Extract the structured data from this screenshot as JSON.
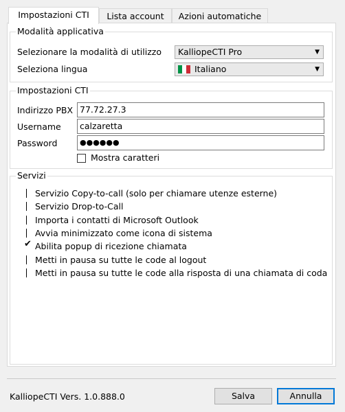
{
  "tabs": [
    {
      "label": "Impostazioni CTI"
    },
    {
      "label": "Lista account"
    },
    {
      "label": "Azioni automatiche"
    }
  ],
  "mode_group": {
    "title": "Modalità applicativa",
    "mode_label": "Selezionare la modalità di utilizzo",
    "mode_value": "KalliopeCTI Pro",
    "language_label": "Seleziona lingua",
    "language_value": "Italiano",
    "flag_colors": [
      "#009246",
      "#ffffff",
      "#ce2b37"
    ]
  },
  "cti_group": {
    "title": "Impostazioni CTI",
    "pbx_label": "Indirizzo PBX",
    "pbx_value": "77.72.27.3",
    "username_label": "Username",
    "username_value": "calzaretta",
    "password_label": "Password",
    "password_value": "●●●●●●",
    "show_chars_label": "Mostra caratteri"
  },
  "services_group": {
    "title": "Servizi",
    "items": [
      {
        "label": "Servizio Copy-to-call (solo per chiamare utenze esterne)",
        "checked": false
      },
      {
        "label": "Servizio Drop-to-Call",
        "checked": false
      },
      {
        "label": "Importa i contatti di Microsoft Outlook",
        "checked": false
      },
      {
        "label": "Avvia minimizzato come icona di sistema",
        "checked": false
      },
      {
        "label": "Abilita popup di ricezione chiamata",
        "checked": true
      },
      {
        "label": "Metti in pausa su tutte le code al logout",
        "checked": false
      },
      {
        "label": "Metti in pausa su tutte le code alla risposta di una chiamata di coda",
        "checked": false
      }
    ]
  },
  "footer": {
    "version": "KalliopeCTI Vers. 1.0.888.0",
    "save_label": "Salva",
    "cancel_label": "Annulla"
  }
}
